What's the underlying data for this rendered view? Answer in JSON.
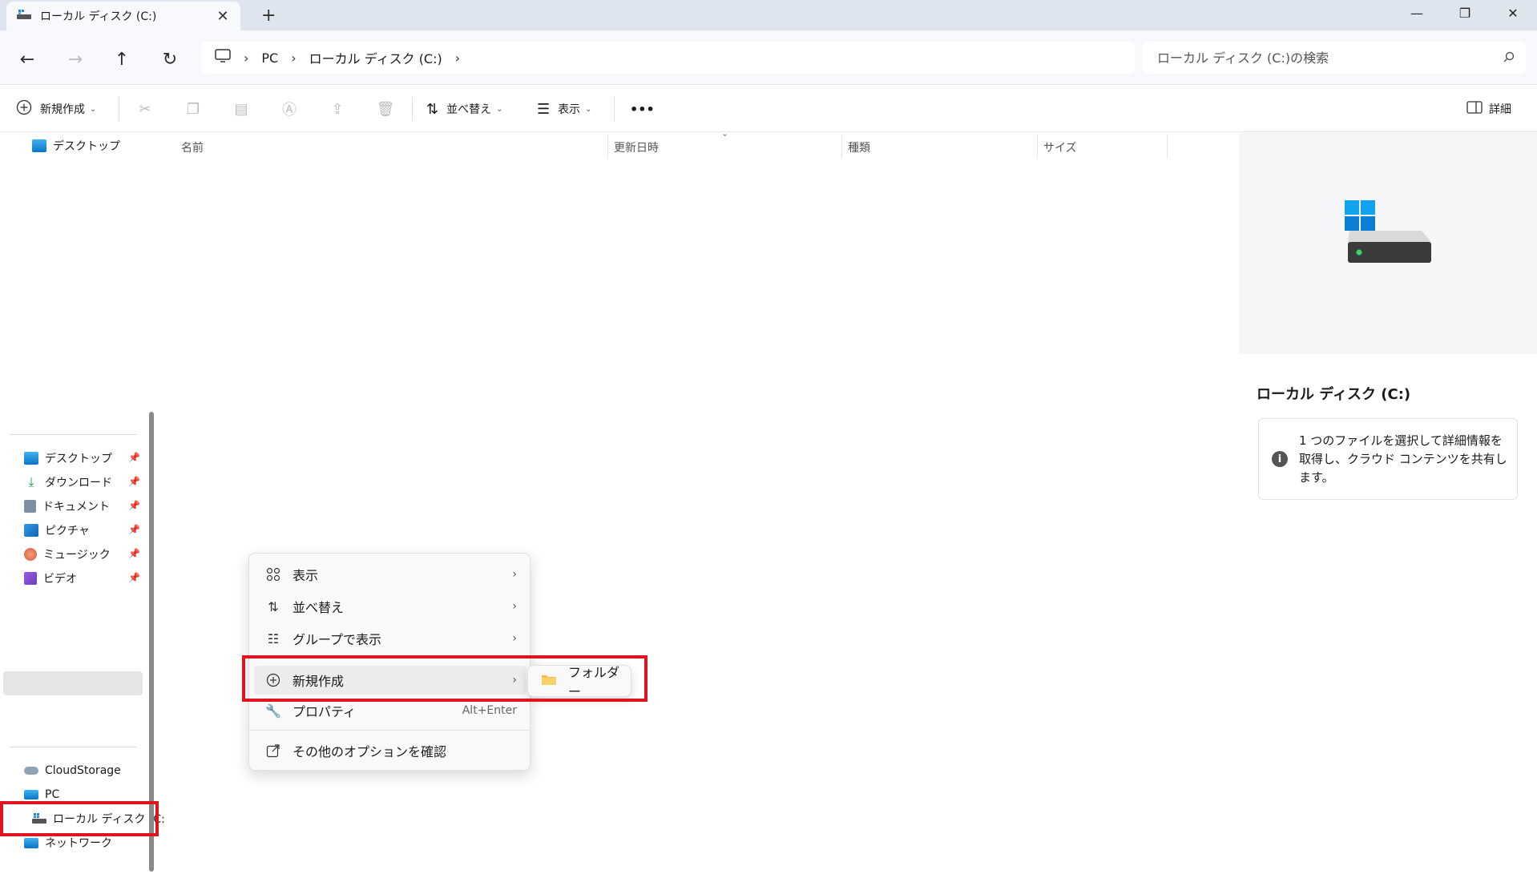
{
  "window": {
    "tab_title": "ローカル ディスク (C:)",
    "tab_close": "✕",
    "tab_add": "+",
    "minimize": "—",
    "maximize": "❐",
    "close": "✕"
  },
  "address": {
    "breadcrumbs": [
      "PC",
      "ローカル ディスク (C:)"
    ],
    "search_placeholder": "ローカル ディスク (C:)の検索"
  },
  "toolbar": {
    "new_label": "新規作成",
    "sort_label": "並べ替え",
    "view_label": "表示",
    "more_label": "•••",
    "details_label": "詳細"
  },
  "nav": {
    "top_item": "デスクトップ",
    "quick_access": [
      {
        "label": "デスクトップ",
        "icon": "desktop-icon"
      },
      {
        "label": "ダウンロード",
        "icon": "download-icon"
      },
      {
        "label": "ドキュメント",
        "icon": "document-icon"
      },
      {
        "label": "ピクチャ",
        "icon": "pictures-icon"
      },
      {
        "label": "ミュージック",
        "icon": "music-icon"
      },
      {
        "label": "ビデオ",
        "icon": "video-icon"
      }
    ],
    "bottom": {
      "cloud": "CloudStorage",
      "pc": "PC",
      "local_disk": "ローカル ディスク (C:",
      "network": "ネットワーク"
    }
  },
  "columns": {
    "name": "名前",
    "modified": "更新日時",
    "type": "種類",
    "size": "サイズ"
  },
  "preview": {
    "title": "ローカル ディスク (C:)",
    "info_text": "1 つのファイルを選択して詳細情報を取得し、クラウド コンテンツを共有します。"
  },
  "context_menu": {
    "view": "表示",
    "sort": "並べ替え",
    "group": "グループで表示",
    "new": "新規作成",
    "properties": "プロパティ",
    "properties_shortcut": "Alt+Enter",
    "more_options": "その他のオプションを確認",
    "submenu_folder": "フォルダー"
  },
  "colors": {
    "highlight_red": "#e0141e",
    "folder_yellow": "#f2c04b",
    "accent_blue": "#0a84d8"
  }
}
